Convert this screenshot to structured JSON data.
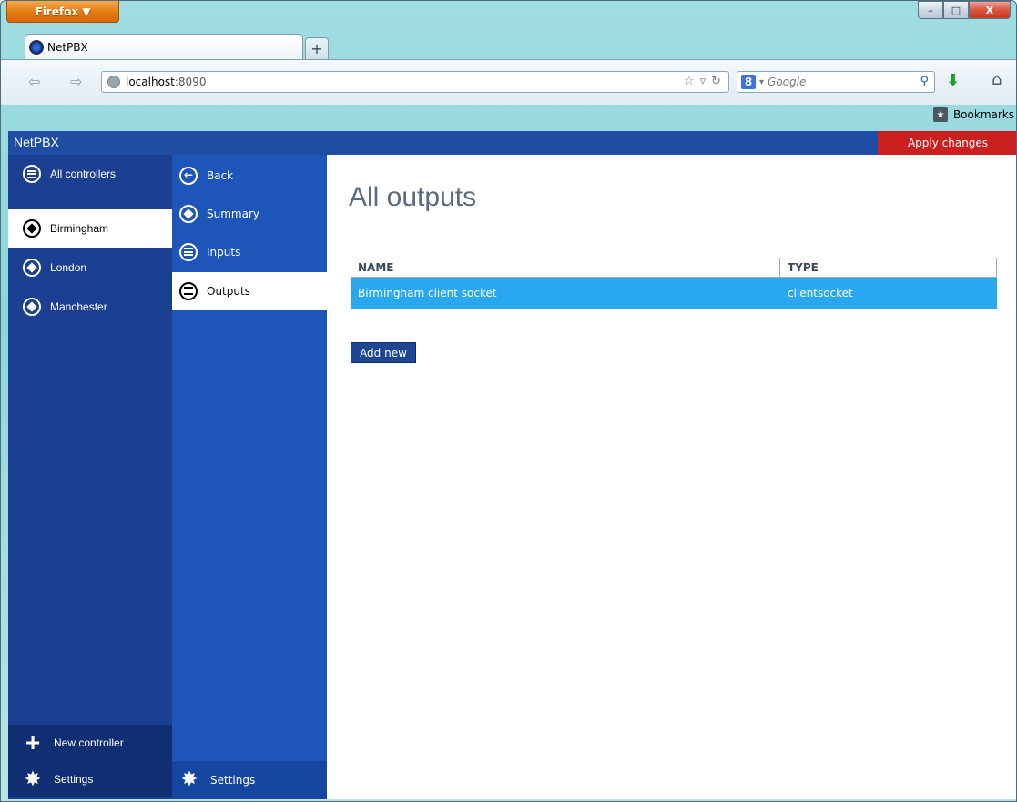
{
  "browser": {
    "menu_button_label": "Firefox ▼",
    "window_controls": {
      "minimize": "–",
      "maximize": "□",
      "close": "X"
    },
    "tab_title": "NetPBX",
    "new_tab_symbol": "+",
    "url_host": "localhost",
    "url_port": ":8090",
    "search_placeholder": "Google",
    "bookmarks_label": "Bookmarks",
    "icons": [
      "back-arrow-icon",
      "forward-arrow-icon",
      "globe-icon",
      "star-icon",
      "dropdown-icon",
      "reload-icon",
      "google-icon",
      "search-icon",
      "download-icon",
      "home-icon",
      "bookmarks-icon"
    ]
  },
  "app": {
    "title": "NetPBX",
    "apply_changes_label": "Apply changes",
    "header_color": "#1e4da3",
    "apply_color": "#cc1f1f"
  },
  "controllers": {
    "all_label": "All controllers",
    "items": [
      {
        "label": "Birmingham",
        "active": true
      },
      {
        "label": "London",
        "active": false
      },
      {
        "label": "Manchester",
        "active": false
      }
    ],
    "new_controller_label": "New controller",
    "settings_label": "Settings"
  },
  "controller_menu": {
    "items": [
      {
        "label": "Back",
        "icon": "back-circle-icon"
      },
      {
        "label": "Summary",
        "icon": "diamond-circle-icon"
      },
      {
        "label": "Inputs",
        "icon": "list-circle-icon"
      },
      {
        "label": "Outputs",
        "icon": "list-circle-icon",
        "active": true
      }
    ],
    "settings_label": "Settings"
  },
  "main": {
    "title": "All outputs",
    "table": {
      "columns": [
        "NAME",
        "TYPE"
      ],
      "rows": [
        {
          "name": "Birmingham client socket",
          "type": "clientsocket",
          "selected": true
        }
      ]
    },
    "add_new_label": "Add new",
    "row_highlight_color": "#29a8ef"
  }
}
